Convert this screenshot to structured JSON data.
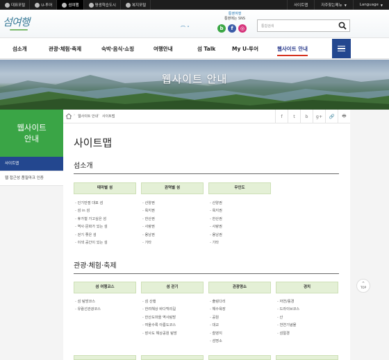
{
  "topbar": {
    "links": [
      {
        "label": "대표포털",
        "icon": "portal-icon"
      },
      {
        "label": "U-투어",
        "icon": "u-tour-icon"
      },
      {
        "label": "섬여행",
        "icon": "island-icon",
        "active": true
      },
      {
        "label": "평생학습도시",
        "icon": "learning-icon"
      },
      {
        "label": "복지포털",
        "icon": "heart-icon"
      }
    ],
    "sitemap": "사이트맵",
    "faq": "자주찾는메뉴",
    "language": "Language"
  },
  "logo": "섬여행",
  "sns": {
    "title_line1": "통영여행",
    "title_line2": "통영에는 SNS",
    "blog": "b",
    "facebook": "f",
    "instagram": "◎"
  },
  "search": {
    "placeholder": "통합검색"
  },
  "gnb": [
    "섬소개",
    "관광·체험·축제",
    "숙박·음식·쇼핑",
    "여행안내",
    "섬 Talk",
    "My U-투어",
    "웹사이트 안내"
  ],
  "hero_title": "웹사이트 안내",
  "lnb": {
    "title_line1": "웹사이트",
    "title_line2": "안내",
    "items": [
      "사이트맵",
      "웹 접근성 품질마크 인증"
    ]
  },
  "breadcrumb": {
    "home": "home",
    "items": [
      "웹사이트 안내",
      "사이트맵"
    ]
  },
  "tools": [
    "f",
    "t",
    "b",
    "g+",
    "🔗",
    "🖶"
  ],
  "page_title": "사이트맵",
  "sections": [
    {
      "title": "섬소개",
      "columns": [
        {
          "header": "테마별 섬",
          "items": [
            "인기만점 대표 섬",
            "섬 in 섬",
            "휴가철 가고싶은 섬",
            "역사·문화가 있는 섬",
            "걷기 좋은 섬",
            "이색 공간이 있는 섬"
          ]
        },
        {
          "header": "권역별 섬",
          "items": [
            "산양권",
            "욕지권",
            "한산권",
            "사량권",
            "용남권",
            "기타"
          ]
        },
        {
          "header": "무인도",
          "items": [
            "산양권",
            "욕지권",
            "한산권",
            "사량권",
            "용남권",
            "기타"
          ]
        }
      ]
    },
    {
      "title": "관광·체험·축제",
      "columns": [
        {
          "header": "섬 여행코스",
          "items": [
            "섬 탐방코스",
            "유람선관광코스"
          ]
        },
        {
          "header": "섬 걷기",
          "items": [
            "섬 산행",
            "한려해상 바다백리길",
            "한산도마을 역사탐방",
            "여울수록 아름도코스",
            "장사도 해상공원 탐방"
          ]
        },
        {
          "header": "관광명소",
          "items": [
            "출렁다리",
            "해수욕장",
            "공원",
            "대교",
            "촬영지",
            "섬명소"
          ]
        },
        {
          "header": "경치",
          "items": [
            "자연/풍경",
            "드라이브코스",
            "산",
            "천연기념물",
            "섬절경"
          ]
        }
      ]
    }
  ],
  "top_button": "TOP"
}
